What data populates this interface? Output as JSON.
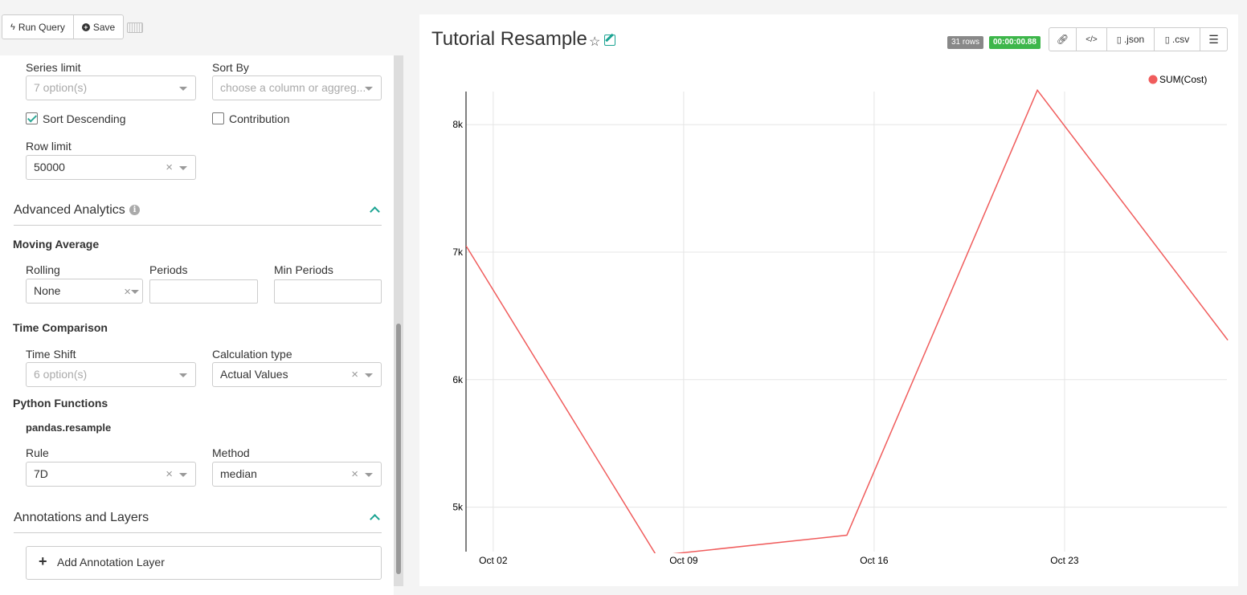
{
  "toolbar": {
    "run_label": "Run Query",
    "save_label": "Save"
  },
  "form": {
    "series_limit": {
      "label": "Series limit",
      "placeholder": "7 option(s)"
    },
    "sort_by": {
      "label": "Sort By",
      "placeholder": "choose a column or aggreg..."
    },
    "sort_descending": {
      "label": "Sort Descending",
      "checked": true
    },
    "contribution": {
      "label": "Contribution",
      "checked": false
    },
    "row_limit": {
      "label": "Row limit",
      "value": "50000"
    },
    "advanced_analytics": {
      "title": "Advanced Analytics",
      "moving_average": {
        "heading": "Moving Average",
        "rolling": {
          "label": "Rolling",
          "value": "None"
        },
        "periods": {
          "label": "Periods",
          "value": ""
        },
        "min_periods": {
          "label": "Min Periods",
          "value": ""
        }
      },
      "time_comparison": {
        "heading": "Time Comparison",
        "time_shift": {
          "label": "Time Shift",
          "placeholder": "6 option(s)"
        },
        "calc_type": {
          "label": "Calculation type",
          "value": "Actual Values"
        }
      },
      "python_functions": {
        "heading": "Python Functions",
        "subheading": "pandas.resample",
        "rule": {
          "label": "Rule",
          "value": "7D"
        },
        "method": {
          "label": "Method",
          "value": "median"
        }
      }
    },
    "annotations": {
      "title": "Annotations and Layers",
      "add_label": "Add Annotation Layer"
    },
    "clear_symbol": "×"
  },
  "header": {
    "title": "Tutorial Resample",
    "rows_badge": "31 rows",
    "time_badge": "00:00:00.88",
    "buttons": {
      "json": ".json",
      "csv": ".csv"
    }
  },
  "colors": {
    "accent": "#1aa392",
    "series": "#f05c5c",
    "success": "#3db64a"
  },
  "chart_data": {
    "type": "line",
    "series": [
      {
        "name": "SUM(Cost)",
        "x": [
          "2017-10-01",
          "2017-10-08",
          "2017-10-15",
          "2017-10-22",
          "2017-10-29"
        ],
        "y": [
          7050,
          4620,
          4780,
          8270,
          6310
        ]
      }
    ],
    "x_ticks": [
      "Oct 02",
      "Oct 09",
      "Oct 16",
      "Oct 23"
    ],
    "y_ticks": [
      "5k",
      "6k",
      "7k",
      "8k"
    ],
    "y_tick_values": [
      5000,
      6000,
      7000,
      8000
    ],
    "legend": "top-right",
    "grid": true
  }
}
